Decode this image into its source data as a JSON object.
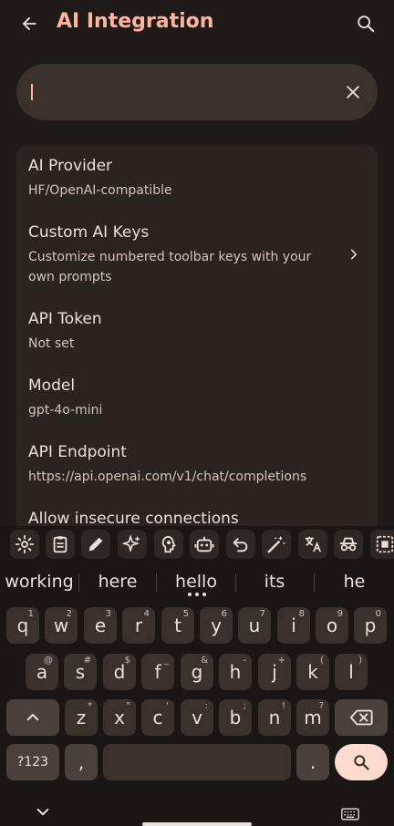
{
  "appbar": {
    "title": "AI Integration"
  },
  "search": {
    "value": "",
    "placeholder": ""
  },
  "prefs": [
    {
      "title": "AI Provider",
      "subtitle": "HF/OpenAI-compatible"
    },
    {
      "title": "Custom AI Keys",
      "subtitle": "Customize numbered toolbar keys with your own prompts"
    },
    {
      "title": "API Token",
      "subtitle": "Not set"
    },
    {
      "title": "Model",
      "subtitle": "gpt-4o-mini"
    },
    {
      "title": "API Endpoint",
      "subtitle": "https://api.openai.com/v1/chat/completions"
    },
    {
      "title": "Allow insecure connections",
      "subtitle": ""
    }
  ],
  "keyboard": {
    "toolbar_icons": [
      "gear-icon",
      "clipboard-icon",
      "pencil-icon",
      "sparkles-icon",
      "brain-icon",
      "robot-icon",
      "undo-icon",
      "magic-wand-icon",
      "translate-icon",
      "incognito-icon",
      "select-all-icon"
    ],
    "suggestions": [
      "working",
      "here",
      "hello",
      "its",
      "he"
    ],
    "row1": [
      {
        "k": "q",
        "h": "1"
      },
      {
        "k": "w",
        "h": "2"
      },
      {
        "k": "e",
        "h": "3"
      },
      {
        "k": "r",
        "h": "4"
      },
      {
        "k": "t",
        "h": "5"
      },
      {
        "k": "y",
        "h": "6"
      },
      {
        "k": "u",
        "h": "7"
      },
      {
        "k": "i",
        "h": "8"
      },
      {
        "k": "o",
        "h": "9"
      },
      {
        "k": "p",
        "h": "0"
      }
    ],
    "row2": [
      {
        "k": "a",
        "h": "@"
      },
      {
        "k": "s",
        "h": "#"
      },
      {
        "k": "d",
        "h": "$"
      },
      {
        "k": "f",
        "h": "_"
      },
      {
        "k": "g",
        "h": "&"
      },
      {
        "k": "h",
        "h": "-"
      },
      {
        "k": "j",
        "h": "+"
      },
      {
        "k": "k",
        "h": "("
      },
      {
        "k": "l",
        "h": ")"
      }
    ],
    "row3": [
      {
        "k": "z",
        "h": "*"
      },
      {
        "k": "x",
        "h": "\""
      },
      {
        "k": "c",
        "h": "'"
      },
      {
        "k": "v",
        "h": ":"
      },
      {
        "k": "b",
        "h": ";"
      },
      {
        "k": "n",
        "h": "!"
      },
      {
        "k": "m",
        "h": "?"
      }
    ],
    "symbols_label": "?123",
    "comma_label": ",",
    "period_label": "."
  },
  "colors": {
    "accent": "#ffb59d",
    "background": "#1f1a18",
    "card": "#2a2320",
    "key": "#3a302c",
    "enter": "#ffdbcf"
  }
}
